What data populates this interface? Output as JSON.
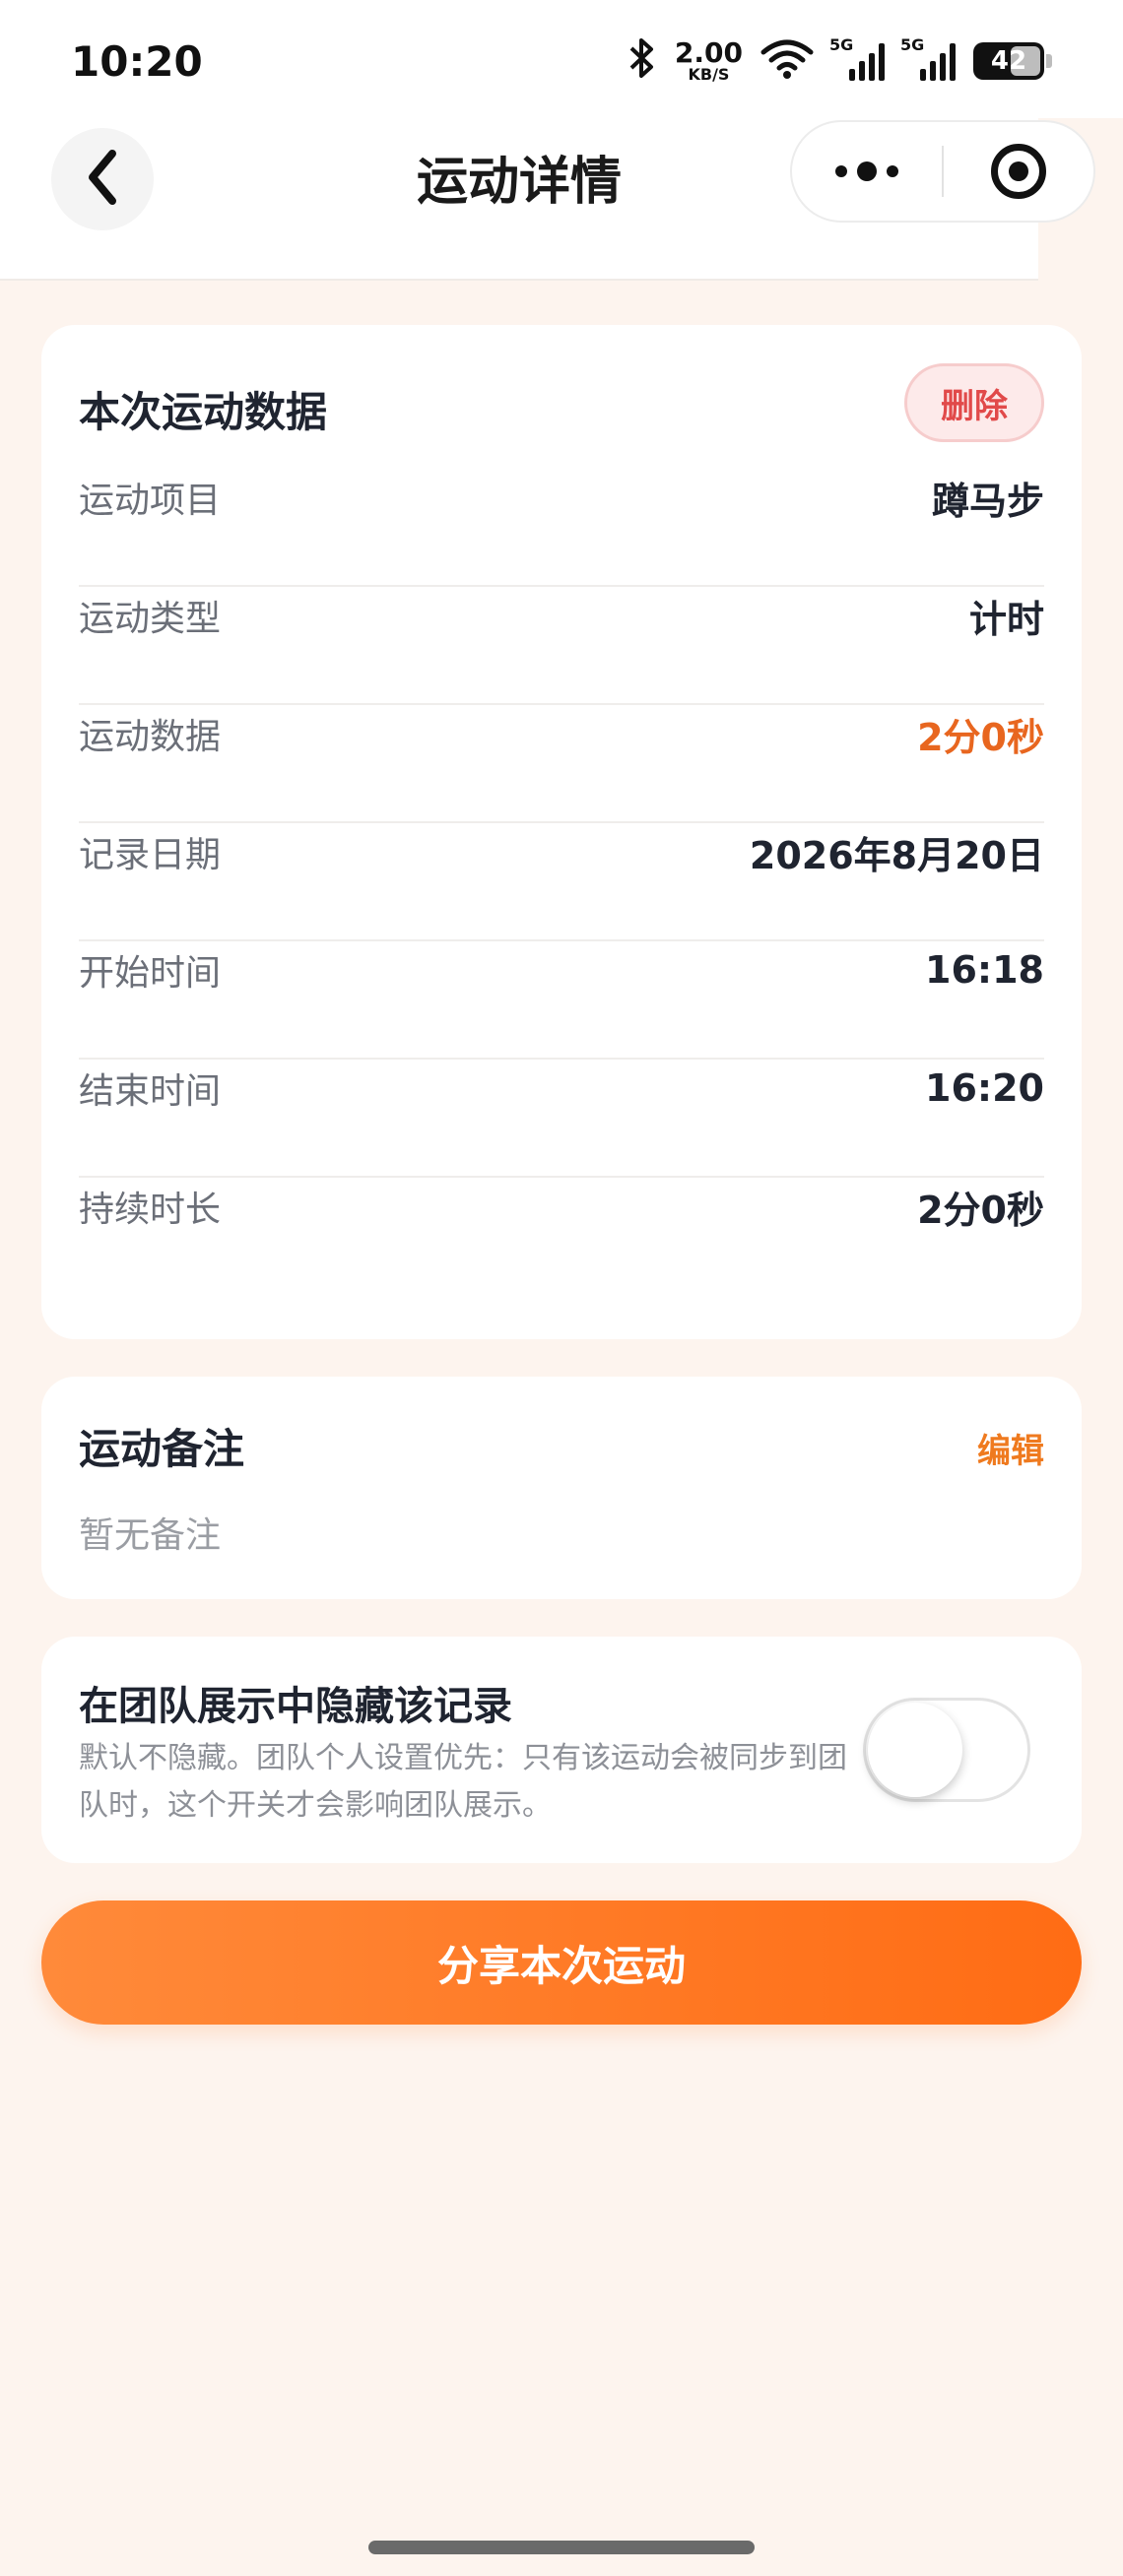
{
  "status_bar": {
    "time": "10:20",
    "bluetooth_icon": "bluetooth-icon",
    "net_speed": "2.00",
    "net_unit": "KB/S",
    "signal_1_label": "5G",
    "signal_2_label": "5G",
    "battery": "42"
  },
  "nav": {
    "title": "运动详情",
    "back_icon": "chevron-left-icon",
    "more_icon": "more-dots-icon",
    "close_icon": "target-icon"
  },
  "data_card": {
    "title": "本次运动数据",
    "delete_label": "删除",
    "rows": [
      {
        "label": "运动项目",
        "value": "蹲马步"
      },
      {
        "label": "运动类型",
        "value": "计时"
      },
      {
        "label": "运动数据",
        "value": "2分0秒"
      },
      {
        "label": "记录日期",
        "value": "2026年8月20日"
      },
      {
        "label": "开始时间",
        "value": "16:18"
      },
      {
        "label": "结束时间",
        "value": "16:20"
      },
      {
        "label": "持续时长",
        "value": "2分0秒"
      }
    ]
  },
  "note_card": {
    "title": "运动备注",
    "edit_label": "编辑",
    "empty_text": "暂无备注"
  },
  "hide_card": {
    "title": "在团队展示中隐藏该记录",
    "description": "默认不隐藏。团队个人设置优先：只有该运动会被同步到团队时，这个开关才会影响团队展示。",
    "toggle_on": false
  },
  "share_button": "分享本次运动",
  "colors": {
    "accent": "#e8661f",
    "button_gradient_start": "#ff8a3a",
    "button_gradient_end": "#ff6c14",
    "delete": "#e14a4a",
    "background": "#fdf4ee"
  }
}
